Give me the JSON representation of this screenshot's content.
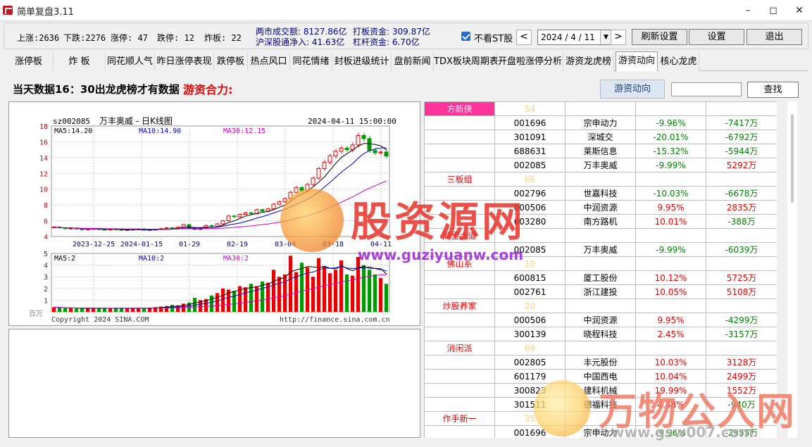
{
  "window": {
    "title": "简单复盘3.11"
  },
  "stats": {
    "up_label": "上涨:2636",
    "down_label": "下跌:2276",
    "limit_up": "涨停: 47",
    "limit_down": "跌停: 12",
    "broken": "炸板: 22",
    "turnover": "两市成交额: 8127.86亿",
    "hs_flow": "沪深股通净入: 41.63亿",
    "board_fund": "打板资金: 309.87亿",
    "lever_fund": "杠杆资金: 6.70亿"
  },
  "controls": {
    "no_st_label": "不看ST股",
    "prev": "<",
    "date": "2024 / 4 / 11",
    "next": ">",
    "refresh": "刷新设置",
    "settings": "设置",
    "exit": "退出"
  },
  "tabs": [
    "涨停板",
    "炸  板",
    "同花顺人气",
    "昨日涨停表现",
    "跌停板",
    "热点风口",
    "同花情绪",
    "封板进级统计",
    "盘前新闻",
    "TDX板块周期表",
    "开盘啦涨停分析",
    "游资龙虎榜",
    "游资动向",
    "核心龙虎"
  ],
  "active_tab": "游资动向",
  "info": {
    "text": "当天数据16：30出龙虎榜才有数据",
    "highlight": "游资合力:"
  },
  "actions": {
    "yz_button": "游资动向",
    "search_value": "",
    "find_button": "查找"
  },
  "chart": {
    "header_code": "sz002085",
    "header_name": "万丰奥威  -  日K线图",
    "header_time": "2024-04-11 15:00:00",
    "ma5": "MA5:14.20",
    "ma10": "MA10:14.90",
    "ma30": "MA30:12.15",
    "vol_ma5": "MA5:2",
    "vol_ma10": "MA10:2",
    "vol_ma30": "MA30:2",
    "vol_unit": "百万",
    "copyright": "Copyright 2024 SINA.COM",
    "url": "http://finance.sina.com.cn",
    "colors": {
      "up": "#e60000",
      "down": "#009900",
      "ma5": "#000000",
      "ma10": "#0000cc",
      "ma30": "#cc00cc"
    }
  },
  "chart_data": {
    "type": "candlestick",
    "title": "万丰奥威 - 日K线图",
    "price_ticks": [
      4,
      6,
      8,
      10,
      12,
      14,
      16,
      18
    ],
    "ylim": [
      4,
      18
    ],
    "x_ticks": [
      "2023-12-25",
      "2024-01-15",
      "01-29",
      "02-19",
      "03-04",
      "03-18",
      "04-11"
    ],
    "volume_ticks": [
      0,
      1,
      2,
      3,
      4,
      5
    ],
    "volume_ylim": [
      0,
      5
    ],
    "series": [
      {
        "name": "close",
        "values": [
          5.2,
          5.1,
          5.0,
          5.05,
          4.95,
          4.9,
          4.95,
          5.0,
          4.9,
          4.85,
          4.95,
          4.9,
          4.8,
          4.85,
          4.9,
          4.95,
          4.8,
          4.85,
          4.9,
          5.0,
          5.1,
          5.05,
          5.2,
          5.5,
          5.1,
          4.9,
          5.0,
          5.4,
          5.3,
          5.6,
          6.0,
          6.6,
          6.5,
          6.8,
          7.0,
          6.9,
          7.4,
          7.2,
          7.5,
          8.1,
          8.4,
          8.8,
          9.6,
          10.2,
          9.8,
          10.6,
          11.4,
          12.6,
          13.4,
          14.2,
          14.8,
          15.2,
          15.0,
          15.6,
          16.8,
          16.4,
          14.9,
          14.6,
          14.7,
          14.2
        ]
      },
      {
        "name": "volume",
        "values": [
          0.4,
          0.35,
          0.3,
          0.3,
          0.28,
          0.3,
          0.32,
          0.3,
          0.3,
          0.28,
          0.3,
          0.35,
          0.3,
          0.3,
          0.32,
          0.3,
          0.33,
          0.35,
          0.4,
          0.45,
          0.5,
          0.6,
          0.55,
          0.7,
          0.8,
          1.2,
          1.0,
          1.1,
          1.4,
          1.6,
          2.0,
          1.9,
          1.8,
          2.2,
          2.1,
          2.4,
          2.2,
          2.6,
          2.5,
          3.6,
          3.0,
          3.2,
          4.8,
          3.4,
          4.2,
          3.8,
          3.0,
          4.6,
          3.9,
          3.3,
          3.6,
          4.4,
          3.2,
          3.1,
          4.7,
          4.0,
          3.6,
          3.2,
          2.9,
          2.4
        ]
      }
    ]
  },
  "table": {
    "rows": [
      {
        "type": "group",
        "name": "方新侠",
        "count": "54",
        "hot": true
      },
      {
        "type": "item",
        "code": "001696",
        "name": "宗申动力",
        "pct": "-9.96%",
        "amount": "-7417万"
      },
      {
        "type": "item",
        "code": "301091",
        "name": "深城交",
        "pct": "-20.01%",
        "amount": "-6792万"
      },
      {
        "type": "item",
        "code": "688631",
        "name": "莱斯信息",
        "pct": "-15.32%",
        "amount": "-5944万"
      },
      {
        "type": "item",
        "code": "002085",
        "name": "万丰奥威",
        "pct": "-9.99%",
        "amount": "5292万"
      },
      {
        "type": "group",
        "name": "三板组",
        "count": "66",
        "hot": false
      },
      {
        "type": "item",
        "code": "002796",
        "name": "世嘉科技",
        "pct": "-10.03%",
        "amount": "-6678万"
      },
      {
        "type": "item",
        "code": "000506",
        "name": "中润资源",
        "pct": "9.95%",
        "amount": "2835万"
      },
      {
        "type": "item",
        "code": "603280",
        "name": "南方路机",
        "pct": "10.01%",
        "amount": "-388万"
      },
      {
        "type": "group",
        "name": "湖里大道",
        "count": "",
        "hot": false
      },
      {
        "type": "item",
        "code": "002085",
        "name": "万丰奥威",
        "pct": "-9.99%",
        "amount": "-6039万"
      },
      {
        "type": "group",
        "name": "佛山系",
        "count": "10",
        "hot": false
      },
      {
        "type": "item",
        "code": "600815",
        "name": "厦工股份",
        "pct": "10.12%",
        "amount": "5725万"
      },
      {
        "type": "item",
        "code": "002761",
        "name": "浙江建投",
        "pct": "10.05%",
        "amount": "5108万"
      },
      {
        "type": "group",
        "name": "炒股养家",
        "count": "20",
        "hot": false
      },
      {
        "type": "item",
        "code": "000506",
        "name": "中润资源",
        "pct": "9.95%",
        "amount": "-4299万"
      },
      {
        "type": "item",
        "code": "300139",
        "name": "晓程科技",
        "pct": "2.45%",
        "amount": "-3157万"
      },
      {
        "type": "group",
        "name": "消闲派",
        "count": "69",
        "hot": false
      },
      {
        "type": "item",
        "code": "002805",
        "name": "丰元股份",
        "pct": "10.03%",
        "amount": "3128万"
      },
      {
        "type": "item",
        "code": "601179",
        "name": "中国西电",
        "pct": "10.04%",
        "amount": "2499万"
      },
      {
        "type": "item",
        "code": "300823",
        "name": "建科机械",
        "pct": "19.99%",
        "amount": "1552万"
      },
      {
        "type": "item",
        "code": "301511",
        "name": "德福科技",
        "pct": "4.48%",
        "amount": "-940万"
      },
      {
        "type": "group",
        "name": "作手新一",
        "count": "35",
        "hot": false
      },
      {
        "type": "item",
        "code": "001696",
        "name": "宗申动力",
        "pct": "-9.96%",
        "amount": "-2955万"
      }
    ]
  },
  "watermarks": {
    "wm1_text": "股资源网",
    "wm1_url": "www.guziyuanw.com",
    "wm2_text": "万物公入网",
    "wm2_url": "www.gsw007.com"
  }
}
